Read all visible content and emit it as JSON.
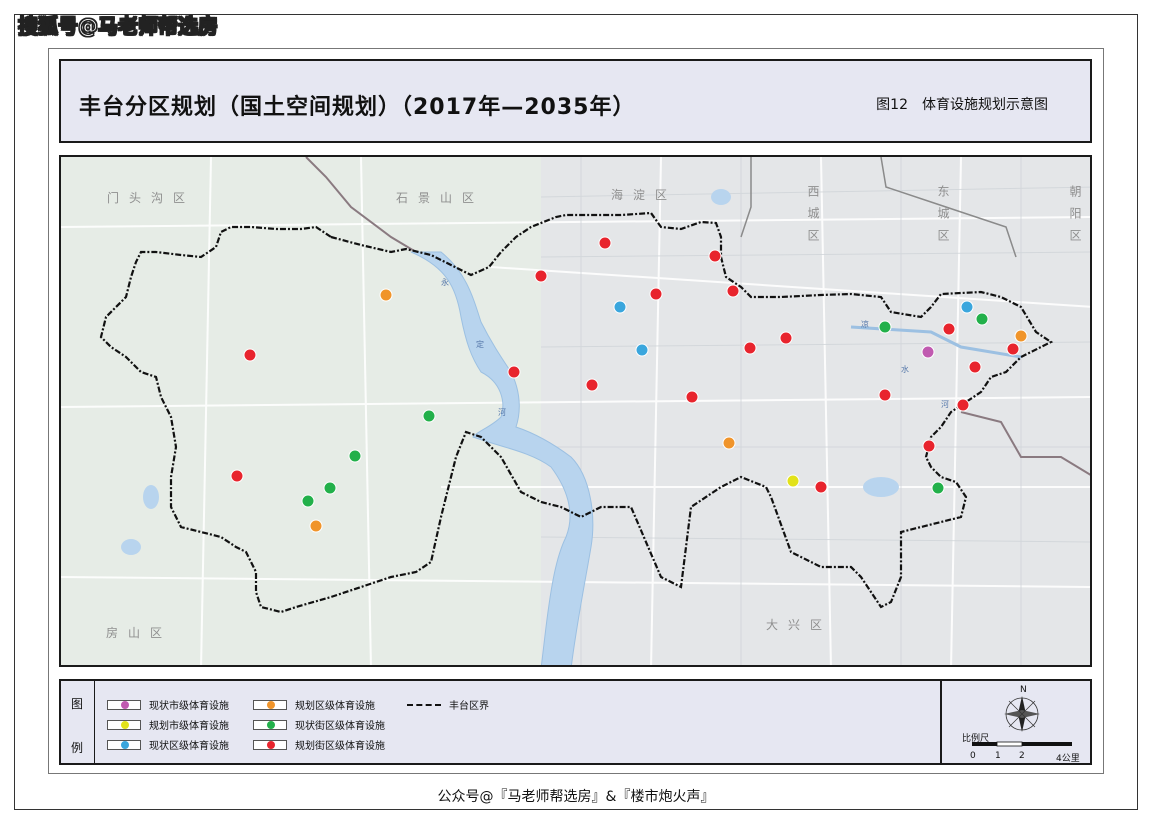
{
  "watermark": "搜狐号@马老师帮选房",
  "title": {
    "main": "丰台分区规划（国土空间规划）（2017年—2035年）",
    "figure": "图12　体育设施规划示意图"
  },
  "map": {
    "region_labels": [
      {
        "text": "门头沟区"
      },
      {
        "text": "石景山区"
      },
      {
        "text": "海淀区"
      },
      {
        "text": "西城区"
      },
      {
        "text": "东城区"
      },
      {
        "text": "朝阳区"
      },
      {
        "text": "房山区"
      },
      {
        "text": "大兴区"
      }
    ],
    "river_labels": [
      "永",
      "定",
      "河",
      "凉",
      "水",
      "河"
    ],
    "colors": {
      "existing_city": "#c05ab0",
      "planned_city": "#e2e21a",
      "existing_district": "#3aa6dd",
      "planned_district": "#f0942a",
      "existing_street": "#22b04a",
      "planned_street": "#e8242d",
      "boundary": "#111111",
      "river": "#b8d4ee"
    }
  },
  "legend": {
    "heading_top": "图",
    "heading_bottom": "例",
    "items": [
      {
        "label": "现状市级体育设施",
        "color": "#c05ab0"
      },
      {
        "label": "规划市级体育设施",
        "color": "#e2e21a"
      },
      {
        "label": "现状区级体育设施",
        "color": "#3aa6dd"
      },
      {
        "label": "规划区级体育设施",
        "color": "#f0942a"
      },
      {
        "label": "现状街区级体育设施",
        "color": "#22b04a"
      },
      {
        "label": "规划街区级体育设施",
        "color": "#e8242d"
      }
    ],
    "boundary_label": "丰台区界",
    "north": "N",
    "scale_label": "比例尺",
    "scale_ticks": [
      "0",
      "1",
      "2",
      "4公里"
    ]
  },
  "footer": "公众号@『马老师帮选房』&『楼市炮火声』"
}
